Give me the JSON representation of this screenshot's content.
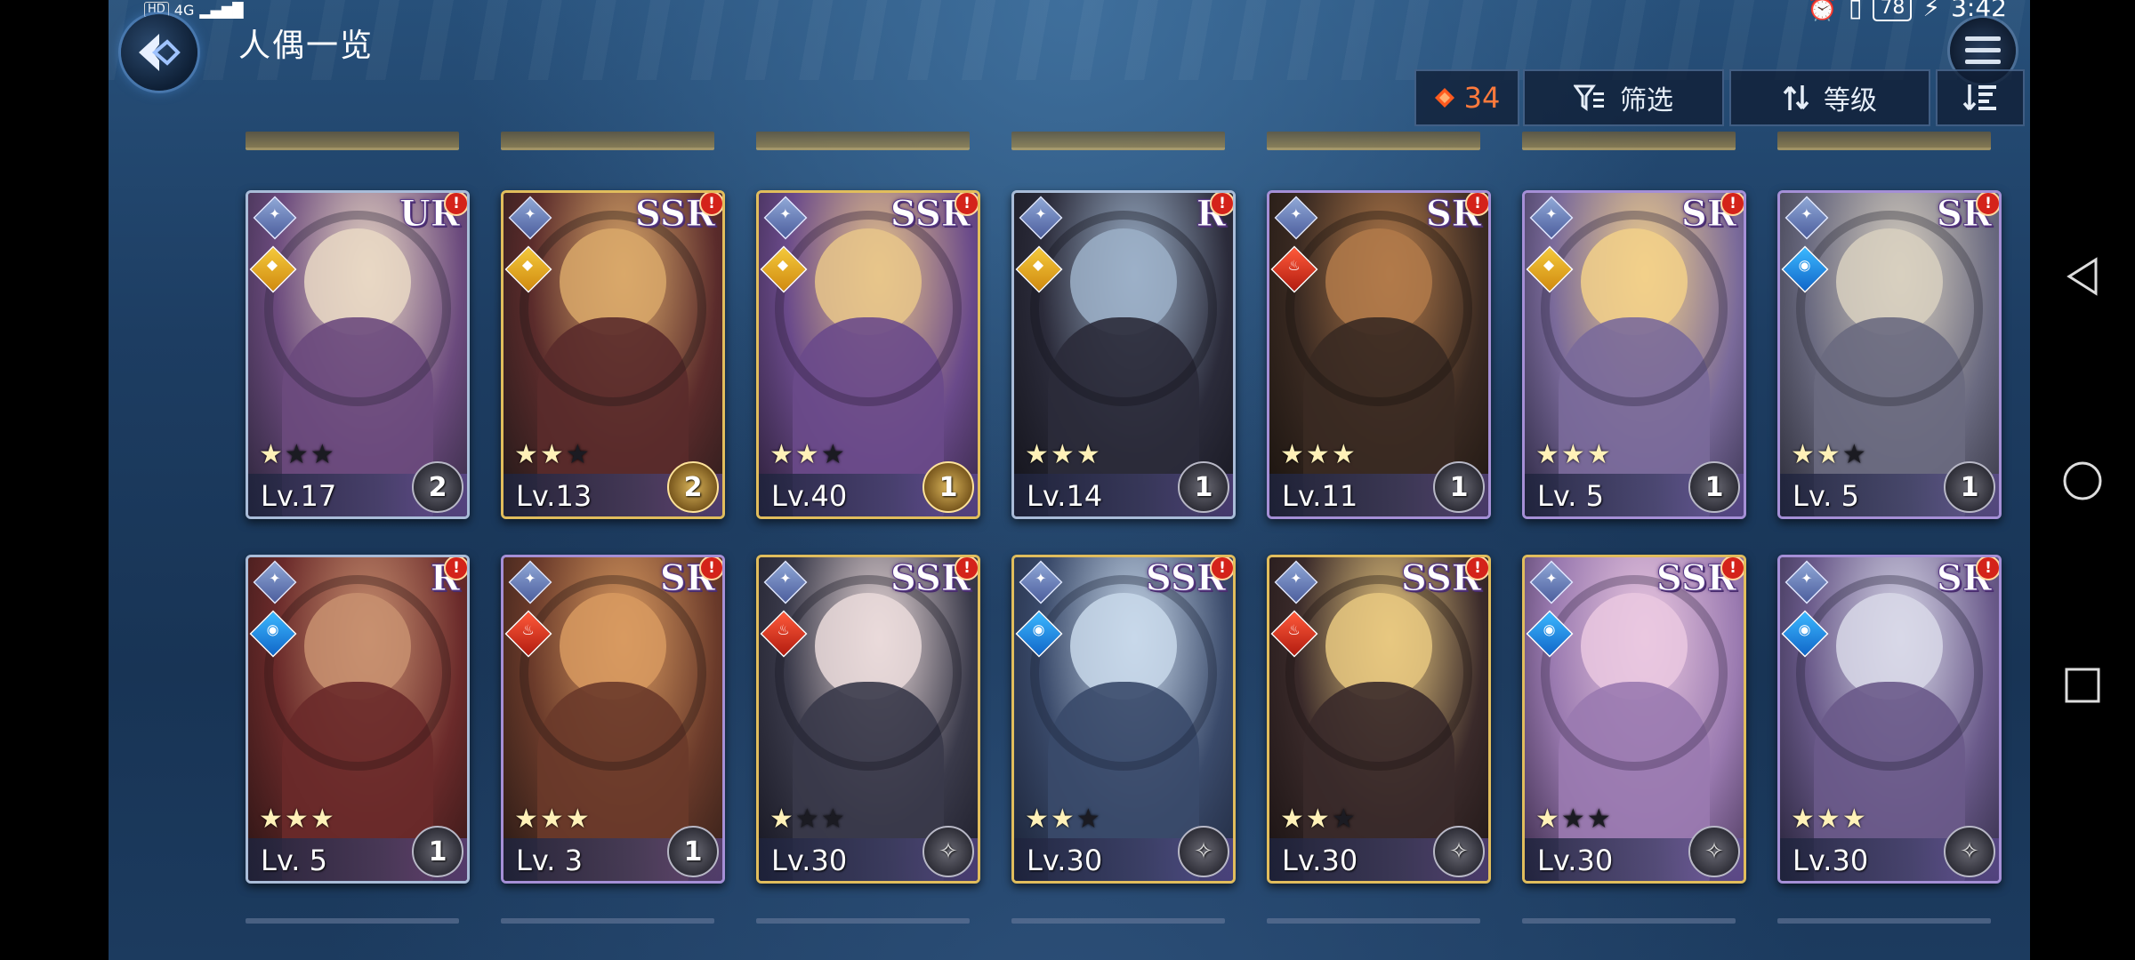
{
  "status_bar": {
    "hd": "HD",
    "network": "4G",
    "battery": "78",
    "time": "3:42"
  },
  "header": {
    "title": "人偶一览",
    "back_icon": "back-arrow-icon",
    "menu_icon": "hamburger-menu-icon"
  },
  "toolbar": {
    "gem_count": "34",
    "filter_label": "筛选",
    "sort_label": "等级"
  },
  "colors": {
    "accent_orange": "#ff7a3c",
    "alert_red": "#d4231a",
    "bg_blue": "#1d3d62"
  },
  "characters": [
    {
      "rarity": "UR",
      "level": "Lv.17",
      "bond": "2",
      "stars": 1,
      "max_stars": 3,
      "element": "light",
      "frame": "silver"
    },
    {
      "rarity": "SSR",
      "level": "Lv.13",
      "bond": "2",
      "stars": 2,
      "max_stars": 3,
      "element": "light",
      "frame": "gold"
    },
    {
      "rarity": "SSR",
      "level": "Lv.40",
      "bond": "1",
      "stars": 2,
      "max_stars": 3,
      "element": "light",
      "frame": "gold"
    },
    {
      "rarity": "R",
      "level": "Lv.14",
      "bond": "1",
      "stars": 3,
      "max_stars": 3,
      "element": "light",
      "frame": "silver"
    },
    {
      "rarity": "SR",
      "level": "Lv.11",
      "bond": "1",
      "stars": 3,
      "max_stars": 3,
      "element": "fire",
      "frame": "purple"
    },
    {
      "rarity": "SR",
      "level": "Lv. 5",
      "bond": "1",
      "stars": 3,
      "max_stars": 3,
      "element": "light",
      "frame": "purple"
    },
    {
      "rarity": "SR",
      "level": "Lv. 5",
      "bond": "1",
      "stars": 2,
      "max_stars": 3,
      "element": "water",
      "frame": "purple"
    },
    {
      "rarity": "R",
      "level": "Lv. 5",
      "bond": "1",
      "stars": 3,
      "max_stars": 3,
      "element": "water",
      "frame": "silver"
    },
    {
      "rarity": "SR",
      "level": "Lv. 3",
      "bond": "1",
      "stars": 3,
      "max_stars": 3,
      "element": "fire",
      "frame": "purple"
    },
    {
      "rarity": "SSR",
      "level": "Lv.30",
      "bond": "",
      "stars": 1,
      "max_stars": 3,
      "element": "fire",
      "frame": "gold"
    },
    {
      "rarity": "SSR",
      "level": "Lv.30",
      "bond": "",
      "stars": 2,
      "max_stars": 3,
      "element": "water",
      "frame": "gold"
    },
    {
      "rarity": "SSR",
      "level": "Lv.30",
      "bond": "",
      "stars": 2,
      "max_stars": 3,
      "element": "fire",
      "frame": "gold"
    },
    {
      "rarity": "SSR",
      "level": "Lv.30",
      "bond": "",
      "stars": 1,
      "max_stars": 3,
      "element": "water",
      "frame": "gold"
    },
    {
      "rarity": "SR",
      "level": "Lv.30",
      "bond": "",
      "stars": 3,
      "max_stars": 3,
      "element": "water",
      "frame": "purple"
    }
  ]
}
